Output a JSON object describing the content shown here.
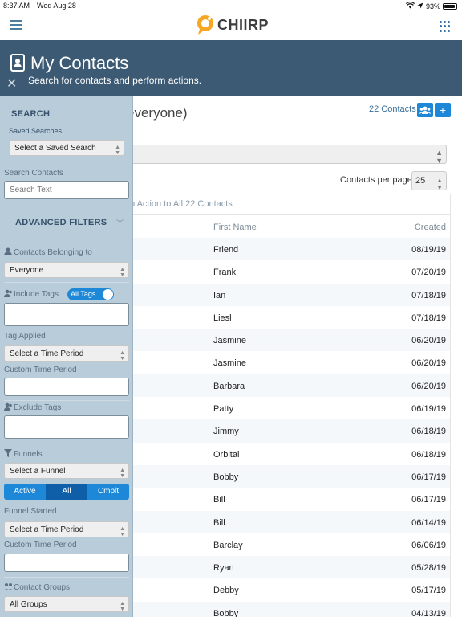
{
  "status_bar": {
    "time": "8:37 AM",
    "date": "Wed Aug 28",
    "battery": "93%",
    "battery_level": 0.93
  },
  "brand": {
    "name": "CHIIRP",
    "accent": "#f5a623"
  },
  "page_header": {
    "title": "My Contacts",
    "subtitle": "Search for contacts and perform actions."
  },
  "main": {
    "list_title": "everyone)",
    "contact_count": "22 Contacts",
    "per_page_label": "Contacts per page:",
    "per_page_value": "25",
    "bulk_action": "o Action to All 22 Contacts",
    "columns": {
      "first_name": "First Name",
      "created": "Created"
    },
    "rows": [
      {
        "first_name": "Friend",
        "created": "08/19/19"
      },
      {
        "first_name": "Frank",
        "created": "07/20/19"
      },
      {
        "first_name": "Ian",
        "created": "07/18/19"
      },
      {
        "first_name": "Liesl",
        "created": "07/18/19"
      },
      {
        "first_name": "Jasmine",
        "created": "06/20/19"
      },
      {
        "first_name": "Jasmine",
        "created": "06/20/19"
      },
      {
        "first_name": "Barbara",
        "created": "06/20/19"
      },
      {
        "first_name": "Patty",
        "created": "06/19/19"
      },
      {
        "first_name": "Jimmy",
        "created": "06/18/19"
      },
      {
        "first_name": "Orbital",
        "created": "06/18/19"
      },
      {
        "first_name": "Bobby",
        "created": "06/17/19"
      },
      {
        "first_name": "Bill",
        "created": "06/17/19"
      },
      {
        "first_name": "Bill",
        "created": "06/14/19"
      },
      {
        "first_name": "Barclay",
        "created": "06/06/19"
      },
      {
        "first_name": "Ryan",
        "created": "05/28/19"
      },
      {
        "first_name": "Debby",
        "created": "05/17/19"
      },
      {
        "first_name": "Bobby",
        "created": "04/13/19"
      }
    ]
  },
  "sidebar": {
    "search_heading": "SEARCH",
    "saved_searches_label": "Saved Searches",
    "saved_search_select": "Select a Saved Search",
    "search_contacts_label": "Search Contacts",
    "search_placeholder": "Search Text",
    "advanced_filters": "ADVANCED FILTERS",
    "belonging_label": "Contacts Belonging to",
    "belonging_value": "Everyone",
    "include_tags_label": "Include Tags",
    "all_tags_toggle": "All Tags",
    "tag_applied_label": "Tag Applied",
    "time_period_select": "Select a Time Period",
    "custom_time_label": "Custom Time Period",
    "exclude_tags_label": "Exclude Tags",
    "funnels_label": "Funnels",
    "funnel_select": "Select a Funnel",
    "funnel_states": [
      "Active",
      "All",
      "Cmplt"
    ],
    "funnel_started_label": "Funnel Started",
    "funnel_time_select": "Select a Time Period",
    "custom_time_label_2": "Custom Time Period",
    "contact_groups_label": "Contact Groups",
    "groups_select": "All Groups"
  }
}
